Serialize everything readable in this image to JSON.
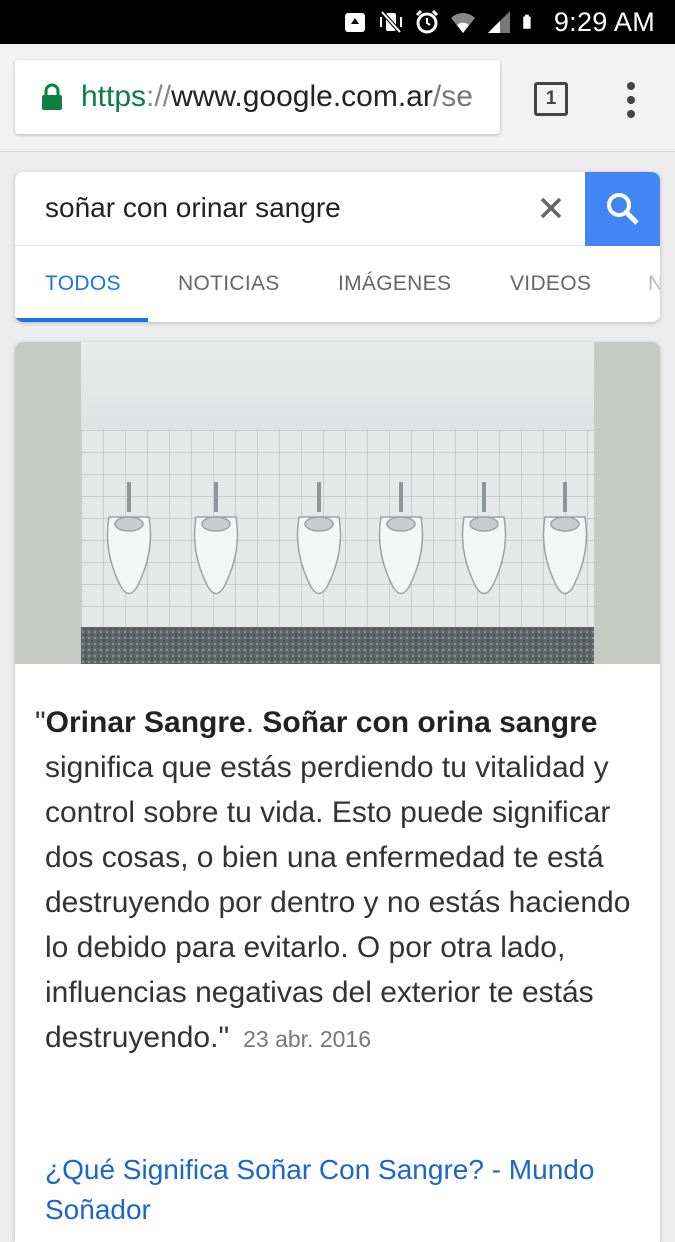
{
  "status_bar": {
    "time": "9:29 AM",
    "icons": [
      "recycle-icon",
      "vibrate-mute-icon",
      "alarm-icon",
      "wifi-icon",
      "signal-icon",
      "battery-icon"
    ]
  },
  "browser": {
    "url_scheme": "https",
    "url_sep": "://",
    "url_host": "www.google.com.ar",
    "url_rest": "/se",
    "tab_count": "1"
  },
  "search": {
    "query": "soñar con orinar sangre",
    "tabs": [
      {
        "label": "TODOS",
        "active": true
      },
      {
        "label": "NOTICIAS",
        "active": false
      },
      {
        "label": "IMÁGENES",
        "active": false
      },
      {
        "label": "VIDEOS",
        "active": false
      },
      {
        "label": "N",
        "active": false
      }
    ]
  },
  "result": {
    "quote_open": "\"",
    "bold_1": "Orinar Sangre",
    "sep": ". ",
    "bold_2": "Soñar con orina sangre",
    "text": "significa que estás perdiendo tu vitalidad y control sobre tu vida. Esto puede significar dos cosas, o bien una enfermedad te está destruyendo por dentro y no estás haciendo lo debido para evitarlo. O por otra lado, influencias negativas del exterior te estás destruyendo.",
    "quote_close": "\"",
    "date": "23 abr. 2016",
    "link_title": "¿Qué Significa Soñar Con Sangre? - Mundo Soñador"
  },
  "colors": {
    "accent": "#4285f4",
    "tab_active": "#1a73e8",
    "link": "#1a66cc",
    "secure": "#0b8043"
  }
}
